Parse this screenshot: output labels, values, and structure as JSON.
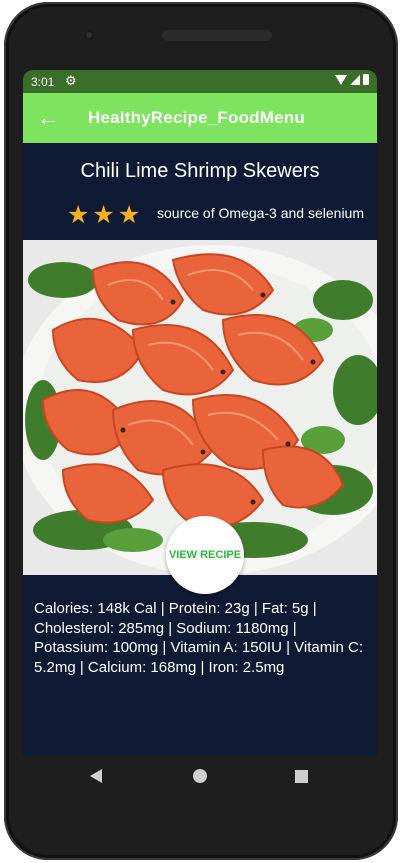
{
  "status": {
    "time": "3:01"
  },
  "appbar": {
    "title": "HealthyRecipe_FoodMenu"
  },
  "recipe": {
    "title": "Chili Lime Shrimp Skewers",
    "rating": 3,
    "rating_max": 3,
    "rating_note": "source of Omega-3 and selenium",
    "view_button": "VIEW RECIPE",
    "nutrition": "Calories: 148k Cal | Protein: 23g | Fat: 5g | Cholesterol: 285mg | Sodium: 1180mg | Potassium: 100mg | Vitamin A: 150IU | Vitamin C: 5.2mg | Calcium: 168mg | Iron: 2.5mg"
  },
  "colors": {
    "background": "#0f1b35",
    "appbar": "#7ee35f",
    "statusbar": "#3a6f2a",
    "star": "#f5b120",
    "button_text": "#2fb73c"
  },
  "icons": [
    "settings-gear-icon",
    "wifi-icon",
    "signal-icon",
    "battery-icon",
    "back-arrow-icon",
    "star-icon",
    "nav-back-icon",
    "nav-home-icon",
    "nav-recents-icon"
  ]
}
